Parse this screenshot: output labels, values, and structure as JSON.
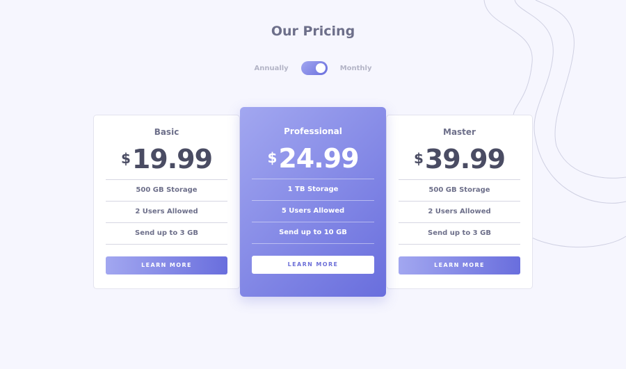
{
  "page": {
    "title": "Our Pricing"
  },
  "billing": {
    "annually_label": "Annually",
    "monthly_label": "Monthly",
    "selected": "Monthly"
  },
  "plans": [
    {
      "name": "Basic",
      "currency": "$",
      "price": "19.99",
      "features": [
        "500 GB Storage",
        "2 Users Allowed",
        "Send up to 3 GB"
      ],
      "button": "LEARN MORE"
    },
    {
      "name": "Professional",
      "currency": "$",
      "price": "24.99",
      "features": [
        "1 TB Storage",
        "5 Users Allowed",
        "Send up to 10 GB"
      ],
      "button": "LEARN MORE"
    },
    {
      "name": "Master",
      "currency": "$",
      "price": "39.99",
      "features": [
        "500 GB Storage",
        "2 Users Allowed",
        "Send up to 3 GB"
      ],
      "button": "LEARN MORE"
    }
  ],
  "colors": {
    "background": "#f6f6fe",
    "gradient_start": "#a2a7f0",
    "gradient_end": "#696edd",
    "text_dark": "#4a4c63",
    "text_muted": "#6d6f8a"
  }
}
